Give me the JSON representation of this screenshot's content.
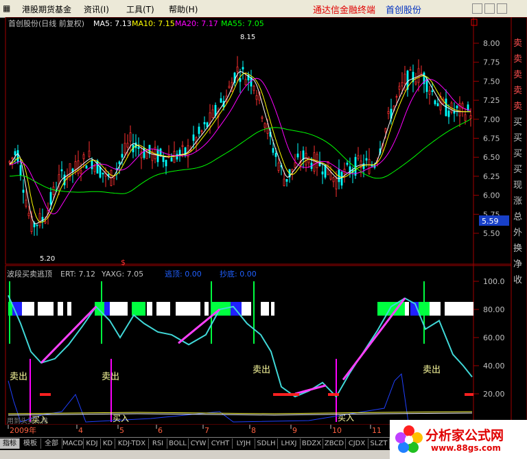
{
  "menu": {
    "items": [
      "港股期货基金",
      "资讯(I)",
      "工具(T)",
      "帮助(H)"
    ],
    "brand": "通达信金融终端",
    "stock_name": "首创股份"
  },
  "price_panel": {
    "title": "首创股份(日线 前复权)",
    "ma5": "MA5: 7.13",
    "ma10": "MA10: 7.15",
    "ma20": "MA20: 7.17",
    "ma55": "MA55: 7.05",
    "high_label": "8.15",
    "low_label": "5.20",
    "current_price": "5.59",
    "y_ticks": [
      "8.00",
      "7.75",
      "7.50",
      "7.25",
      "7.00",
      "6.75",
      "6.50",
      "6.25",
      "6.00",
      "5.75",
      "5.50"
    ],
    "side_labels": [
      "卖",
      "卖",
      "卖",
      "卖",
      "卖",
      "买",
      "买",
      "买",
      "买",
      "现",
      "涨",
      "总",
      "外",
      "换",
      "净",
      "收"
    ]
  },
  "indicator_panel": {
    "title": "波段买卖逃顶",
    "ert": "ERT: 7.12",
    "yaxg": "YAXG: 7.05",
    "escape_label": "逃顶: 0.00",
    "bottom_label": "抄底: 0.00",
    "y_ticks": [
      "100.0",
      "80.00",
      "60.00",
      "40.00",
      "20.00"
    ],
    "sell_label": "卖出",
    "buy_label": "买入",
    "gray_label": "用到头买入排"
  },
  "time_axis": {
    "labels": [
      "2009年",
      "4",
      "5",
      "6",
      "7",
      "8",
      "9",
      "10",
      "11"
    ]
  },
  "tabs": [
    "指标",
    "模板",
    "全部",
    "MACD",
    "KDJ",
    "KD",
    "KDJ-TDX",
    "RSI",
    "BOLL",
    "CYW",
    "CYHT",
    "LYJH",
    "SDLH",
    "LHXJ",
    "BDZX",
    "ZBCD",
    "CJDX",
    "SLZT"
  ],
  "logo": {
    "title": "分析家公式网",
    "url": "www.88gs.com"
  },
  "colors": {
    "up": "#ff3030",
    "down": "#00ffff",
    "ma5": "#ffffff",
    "ma10": "#ffff00",
    "ma20": "#ff00ff",
    "ma55": "#00ff00",
    "grid": "#a00000",
    "axis_text": "#c0c0c0"
  }
}
